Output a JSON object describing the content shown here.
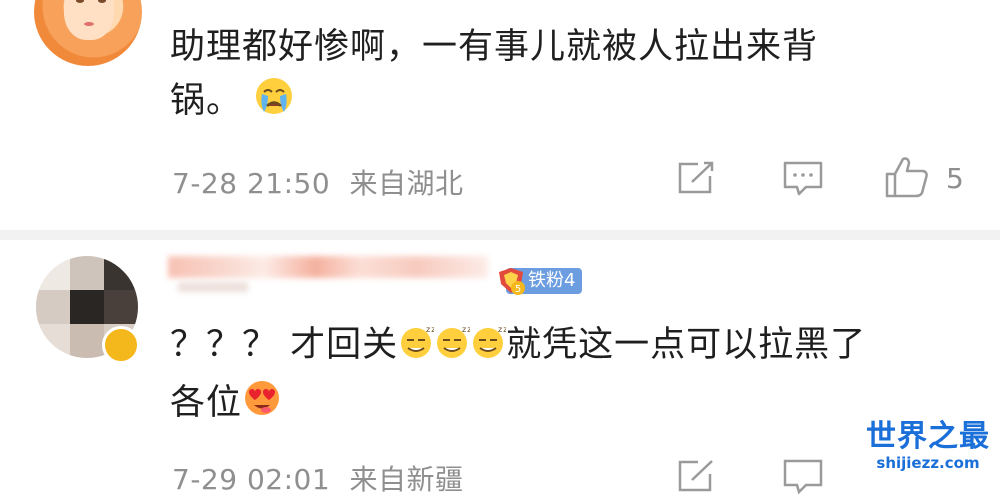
{
  "comments": [
    {
      "text_line1": "助理都好惨啊，一有事儿就被人拉出来背",
      "text_line2": "锅。",
      "emoji": "crying-face-emoji",
      "time": "7-28 21:50",
      "location": "来自湖北",
      "likes": "5"
    },
    {
      "badge": "铁粉4",
      "text_line1": "？？？ 才回关",
      "text_line1_tail": "就凭这一点可以拉黑了",
      "text_line2": "各位",
      "emoji_inline": "sleepy-grin-emoji",
      "emoji_end": "heart-eyes-emoji",
      "time": "7-29 02:01",
      "location": "来自新疆"
    }
  ],
  "watermark": {
    "title": "世界之最",
    "url": "shijiezz.com"
  },
  "colors": {
    "meta_gray": "#8f8f8f",
    "badge_blue": "#6c9de0",
    "watermark_blue": "#1a6fd8"
  }
}
